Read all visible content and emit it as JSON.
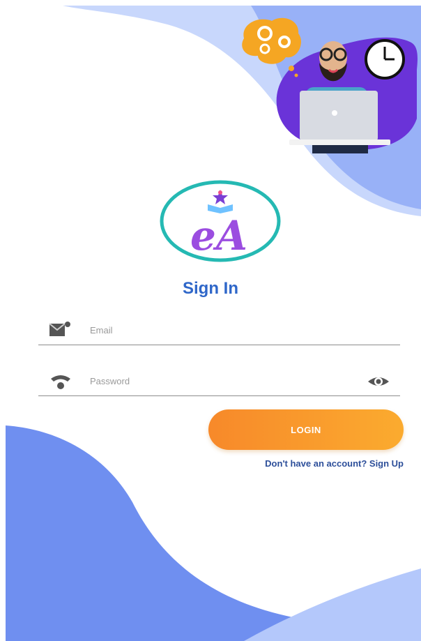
{
  "header": {
    "title": "Sign In"
  },
  "logo": {
    "letters": "eA"
  },
  "form": {
    "email": {
      "placeholder": "Email",
      "value": "",
      "icon": "mail-icon"
    },
    "password": {
      "placeholder": "Password",
      "value": "",
      "icon": "wifi-icon",
      "toggle_icon": "eye-icon"
    }
  },
  "login_button": {
    "label": "LOGIN"
  },
  "signup_link": {
    "label": "Don't have an account? Sign Up"
  },
  "colors": {
    "accent_blue": "#2f67c9",
    "wave_blue": "#6f8ff0",
    "wave_light": "#b4c8fb",
    "button_start": "#f7892a",
    "button_end": "#fbab2f",
    "link": "#2d4f9a"
  }
}
